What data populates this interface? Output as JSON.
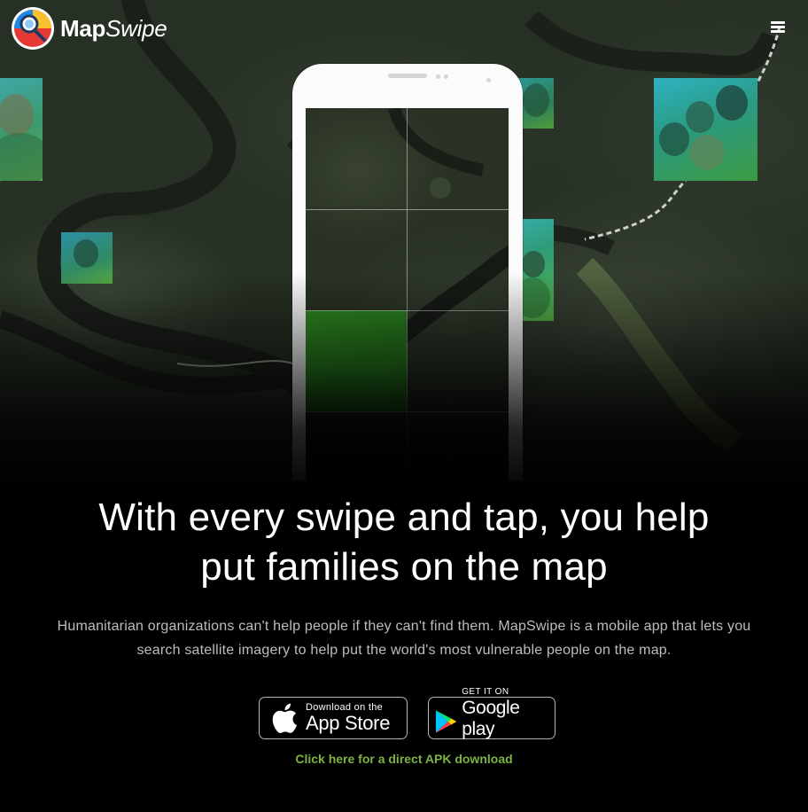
{
  "header": {
    "logo_text_bold": "Map",
    "logo_text_italic": "Swipe",
    "menu_icon": "hamburger-menu-icon"
  },
  "hero": {
    "headline_line1": "With every swipe and tap, you help",
    "headline_line2": "put families on the map",
    "description_line1": "Humanitarian organizations can't help people if they can't find them. MapSwipe is a mobile app that lets you",
    "description_line2": "search satellite imagery to help put the world's most vulnerable people on the map."
  },
  "downloads": {
    "appstore": {
      "small": "Download on the",
      "big": "App Store",
      "icon": "apple-icon"
    },
    "googleplay": {
      "small": "GET IT ON",
      "big": "Google play",
      "icon": "google-play-icon"
    },
    "apk_link": "Click here for a direct APK download"
  },
  "colors": {
    "background": "#000000",
    "link_green": "#7cb342",
    "tile_teal": "#2fb2c2",
    "tile_green": "#3d9b43"
  }
}
